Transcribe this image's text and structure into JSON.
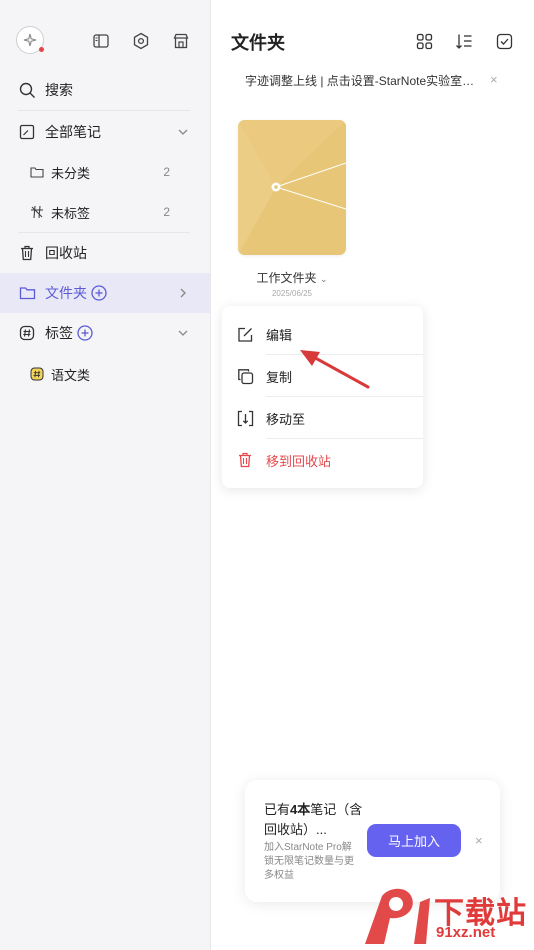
{
  "sidebar": {
    "search_label": "搜索",
    "all_notes_label": "全部笔记",
    "uncategorized_label": "未分类",
    "uncategorized_count": "2",
    "untagged_label": "未标签",
    "untagged_count": "2",
    "trash_label": "回收站",
    "folders_label": "文件夹",
    "tags_label": "标签",
    "tag_items": [
      {
        "label": "语文类"
      }
    ]
  },
  "main": {
    "title": "文件夹",
    "notice": "字迹调整上线 | 点击设置-StarNote实验室开...",
    "notice_close": "×",
    "folder": {
      "name": "工作文件夹",
      "date": "2025/06/25",
      "color": "#e7c777"
    }
  },
  "context_menu": {
    "items": [
      {
        "label": "编辑"
      },
      {
        "label": "复制"
      },
      {
        "label": "移动至"
      },
      {
        "label": "移到回收站"
      }
    ]
  },
  "promo": {
    "title_prefix": "已有",
    "title_count": "4本",
    "title_suffix": "笔记（含回收站）...",
    "description": "加入StarNote Pro解锁无限笔记数量与更多权益",
    "button_label": "马上加入",
    "close": "×"
  },
  "watermark": {
    "text": "下载站",
    "url": "91xz.net"
  },
  "colors": {
    "accent": "#6562f0",
    "active_bg": "#e9e8f7",
    "danger": "#e5484d",
    "annotation_arrow": "#d83a3a"
  }
}
